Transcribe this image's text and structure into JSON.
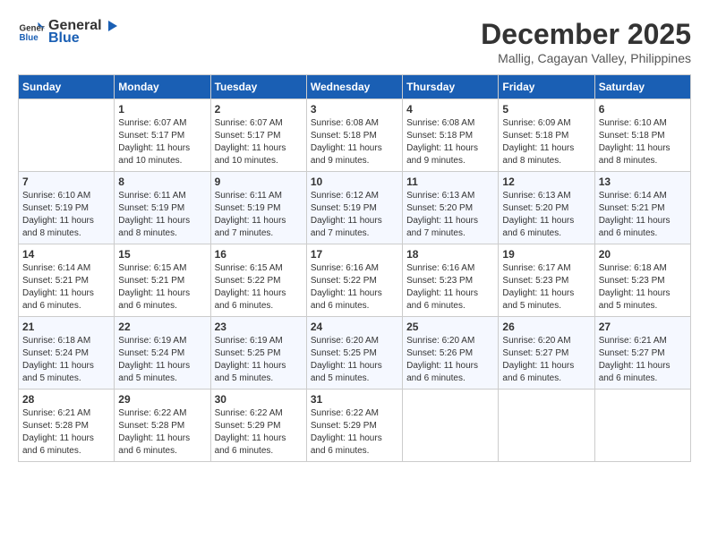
{
  "header": {
    "logo_line1": "General",
    "logo_line2": "Blue",
    "month_title": "December 2025",
    "subtitle": "Mallig, Cagayan Valley, Philippines"
  },
  "days_of_week": [
    "Sunday",
    "Monday",
    "Tuesday",
    "Wednesday",
    "Thursday",
    "Friday",
    "Saturday"
  ],
  "weeks": [
    [
      {
        "day": "",
        "sunrise": "",
        "sunset": "",
        "daylight": ""
      },
      {
        "day": "1",
        "sunrise": "6:07 AM",
        "sunset": "5:17 PM",
        "daylight": "11 hours and 10 minutes."
      },
      {
        "day": "2",
        "sunrise": "6:07 AM",
        "sunset": "5:17 PM",
        "daylight": "11 hours and 10 minutes."
      },
      {
        "day": "3",
        "sunrise": "6:08 AM",
        "sunset": "5:18 PM",
        "daylight": "11 hours and 9 minutes."
      },
      {
        "day": "4",
        "sunrise": "6:08 AM",
        "sunset": "5:18 PM",
        "daylight": "11 hours and 9 minutes."
      },
      {
        "day": "5",
        "sunrise": "6:09 AM",
        "sunset": "5:18 PM",
        "daylight": "11 hours and 8 minutes."
      },
      {
        "day": "6",
        "sunrise": "6:10 AM",
        "sunset": "5:18 PM",
        "daylight": "11 hours and 8 minutes."
      }
    ],
    [
      {
        "day": "7",
        "sunrise": "6:10 AM",
        "sunset": "5:19 PM",
        "daylight": "11 hours and 8 minutes."
      },
      {
        "day": "8",
        "sunrise": "6:11 AM",
        "sunset": "5:19 PM",
        "daylight": "11 hours and 8 minutes."
      },
      {
        "day": "9",
        "sunrise": "6:11 AM",
        "sunset": "5:19 PM",
        "daylight": "11 hours and 7 minutes."
      },
      {
        "day": "10",
        "sunrise": "6:12 AM",
        "sunset": "5:19 PM",
        "daylight": "11 hours and 7 minutes."
      },
      {
        "day": "11",
        "sunrise": "6:13 AM",
        "sunset": "5:20 PM",
        "daylight": "11 hours and 7 minutes."
      },
      {
        "day": "12",
        "sunrise": "6:13 AM",
        "sunset": "5:20 PM",
        "daylight": "11 hours and 6 minutes."
      },
      {
        "day": "13",
        "sunrise": "6:14 AM",
        "sunset": "5:21 PM",
        "daylight": "11 hours and 6 minutes."
      }
    ],
    [
      {
        "day": "14",
        "sunrise": "6:14 AM",
        "sunset": "5:21 PM",
        "daylight": "11 hours and 6 minutes."
      },
      {
        "day": "15",
        "sunrise": "6:15 AM",
        "sunset": "5:21 PM",
        "daylight": "11 hours and 6 minutes."
      },
      {
        "day": "16",
        "sunrise": "6:15 AM",
        "sunset": "5:22 PM",
        "daylight": "11 hours and 6 minutes."
      },
      {
        "day": "17",
        "sunrise": "6:16 AM",
        "sunset": "5:22 PM",
        "daylight": "11 hours and 6 minutes."
      },
      {
        "day": "18",
        "sunrise": "6:16 AM",
        "sunset": "5:23 PM",
        "daylight": "11 hours and 6 minutes."
      },
      {
        "day": "19",
        "sunrise": "6:17 AM",
        "sunset": "5:23 PM",
        "daylight": "11 hours and 5 minutes."
      },
      {
        "day": "20",
        "sunrise": "6:18 AM",
        "sunset": "5:23 PM",
        "daylight": "11 hours and 5 minutes."
      }
    ],
    [
      {
        "day": "21",
        "sunrise": "6:18 AM",
        "sunset": "5:24 PM",
        "daylight": "11 hours and 5 minutes."
      },
      {
        "day": "22",
        "sunrise": "6:19 AM",
        "sunset": "5:24 PM",
        "daylight": "11 hours and 5 minutes."
      },
      {
        "day": "23",
        "sunrise": "6:19 AM",
        "sunset": "5:25 PM",
        "daylight": "11 hours and 5 minutes."
      },
      {
        "day": "24",
        "sunrise": "6:20 AM",
        "sunset": "5:25 PM",
        "daylight": "11 hours and 5 minutes."
      },
      {
        "day": "25",
        "sunrise": "6:20 AM",
        "sunset": "5:26 PM",
        "daylight": "11 hours and 6 minutes."
      },
      {
        "day": "26",
        "sunrise": "6:20 AM",
        "sunset": "5:27 PM",
        "daylight": "11 hours and 6 minutes."
      },
      {
        "day": "27",
        "sunrise": "6:21 AM",
        "sunset": "5:27 PM",
        "daylight": "11 hours and 6 minutes."
      }
    ],
    [
      {
        "day": "28",
        "sunrise": "6:21 AM",
        "sunset": "5:28 PM",
        "daylight": "11 hours and 6 minutes."
      },
      {
        "day": "29",
        "sunrise": "6:22 AM",
        "sunset": "5:28 PM",
        "daylight": "11 hours and 6 minutes."
      },
      {
        "day": "30",
        "sunrise": "6:22 AM",
        "sunset": "5:29 PM",
        "daylight": "11 hours and 6 minutes."
      },
      {
        "day": "31",
        "sunrise": "6:22 AM",
        "sunset": "5:29 PM",
        "daylight": "11 hours and 6 minutes."
      },
      {
        "day": "",
        "sunrise": "",
        "sunset": "",
        "daylight": ""
      },
      {
        "day": "",
        "sunrise": "",
        "sunset": "",
        "daylight": ""
      },
      {
        "day": "",
        "sunrise": "",
        "sunset": "",
        "daylight": ""
      }
    ]
  ],
  "labels": {
    "sunrise_prefix": "Sunrise: ",
    "sunset_prefix": "Sunset: ",
    "daylight_prefix": "Daylight: "
  }
}
